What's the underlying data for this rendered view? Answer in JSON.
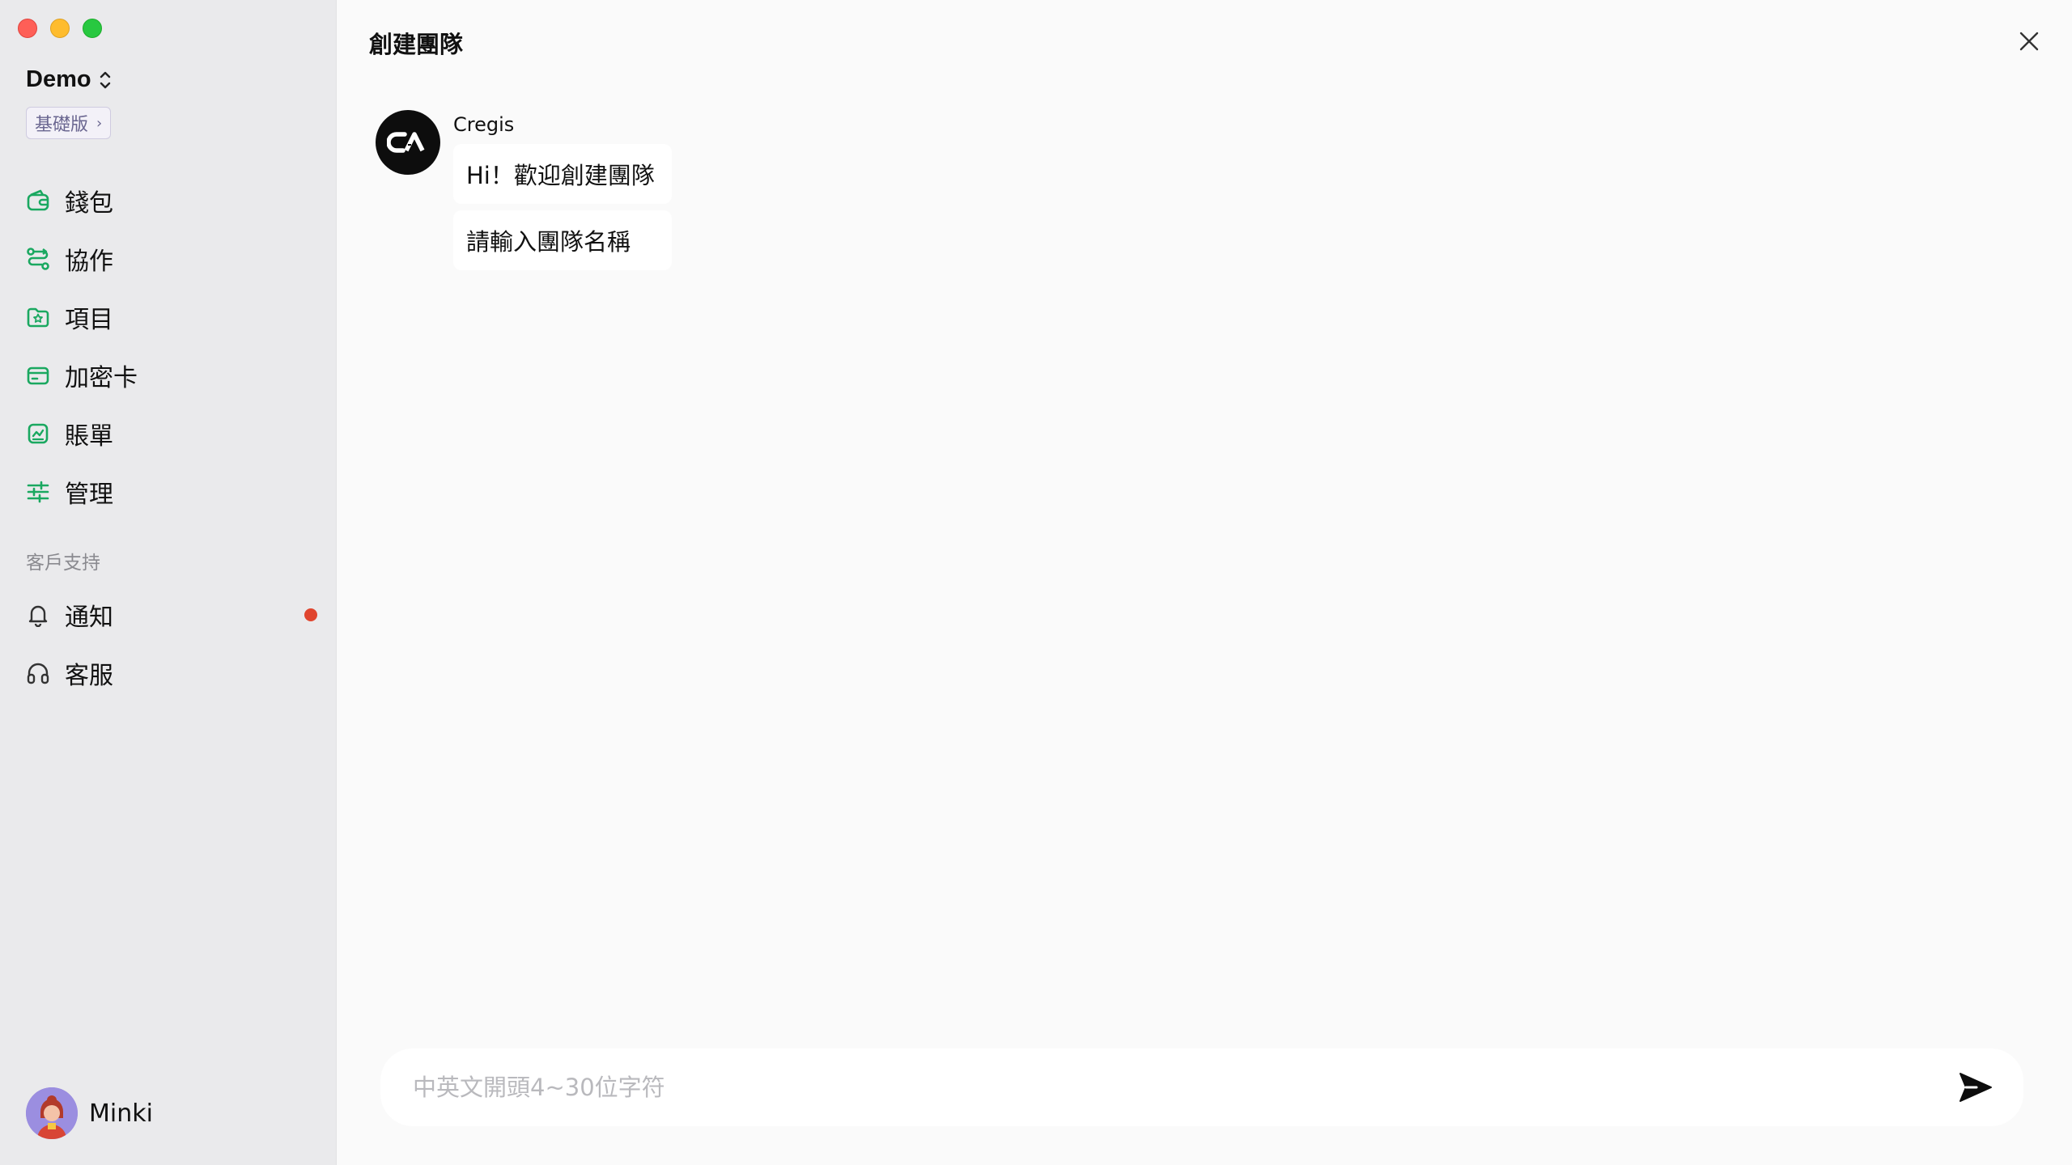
{
  "app": {
    "org_name": "Demo",
    "plan": "基礎版",
    "user_name": "Minki"
  },
  "sidebar": {
    "items": [
      {
        "label": "錢包",
        "icon": "wallet-icon"
      },
      {
        "label": "協作",
        "icon": "collaboration-icon"
      },
      {
        "label": "項目",
        "icon": "project-icon"
      },
      {
        "label": "加密卡",
        "icon": "card-icon"
      },
      {
        "label": "賬單",
        "icon": "bill-icon"
      },
      {
        "label": "管理",
        "icon": "sliders-icon"
      }
    ],
    "support_label": "客戶支持",
    "support_items": [
      {
        "label": "通知",
        "icon": "bell-icon",
        "has_unread": true
      },
      {
        "label": "客服",
        "icon": "headset-icon"
      }
    ]
  },
  "main": {
    "title": "創建團隊",
    "messages": {
      "sender": "Cregis",
      "lines": [
        "Hi！歡迎創建團隊",
        "請輸入團隊名稱"
      ]
    },
    "composer": {
      "placeholder": "中英文開頭4~30位字符",
      "value": ""
    }
  },
  "colors": {
    "accent": "#1aa860",
    "sidebar_bg": "#eaeaec",
    "unread_dot": "#e0452f",
    "plan_badge_text": "#6a6690"
  }
}
